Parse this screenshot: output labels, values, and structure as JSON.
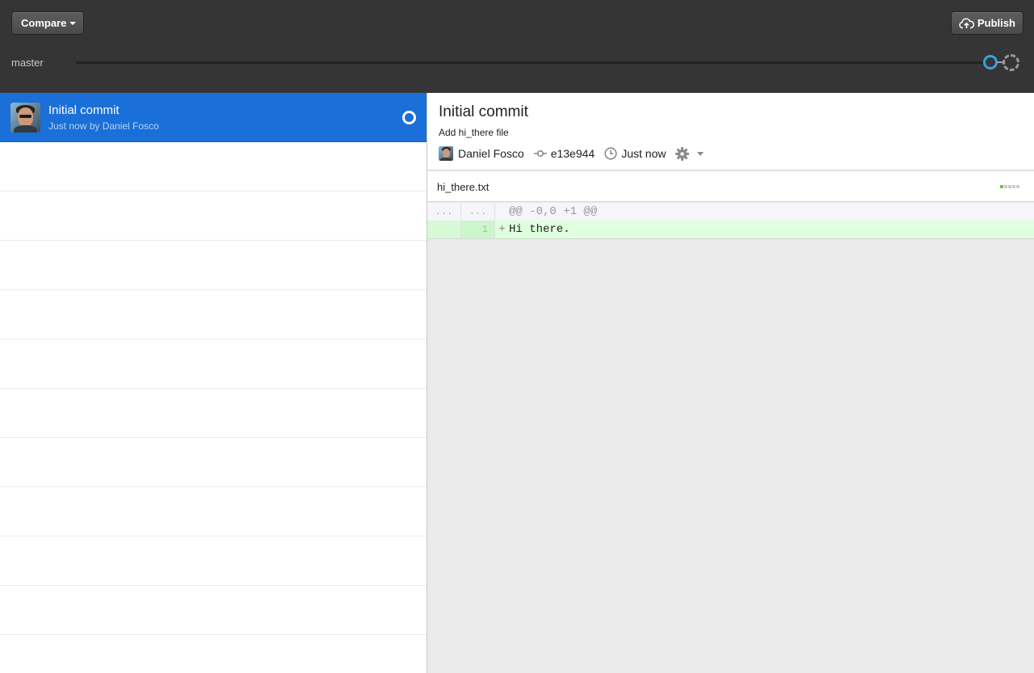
{
  "toolbar": {
    "compare_label": "Compare",
    "publish_label": "Publish",
    "branch_name": "master",
    "accent_color": "#3d9ee0"
  },
  "commits": [
    {
      "title": "Initial commit",
      "subtitle": "Just now by Daniel Fosco",
      "selected": true,
      "status_icon": "unpushed-commit-icon"
    }
  ],
  "commit_detail": {
    "title": "Initial commit",
    "description": "Add hi_there file",
    "author": "Daniel Fosco",
    "sha": "e13e944",
    "time": "Just now",
    "selected_color": "#1a6fd8"
  },
  "file": {
    "name": "hi_there.txt",
    "diffstat_colors": [
      "#6cc644",
      "#cccccc",
      "#cccccc",
      "#cccccc",
      "#cccccc"
    ]
  },
  "diff": {
    "hunk_old_gutter": "...",
    "hunk_new_gutter": "...",
    "hunk_header": "@@ -0,0 +1 @@",
    "lines": [
      {
        "old": "",
        "new": "1",
        "marker": "+",
        "text": "Hi there."
      }
    ],
    "added_bg": "#dfffdf"
  }
}
